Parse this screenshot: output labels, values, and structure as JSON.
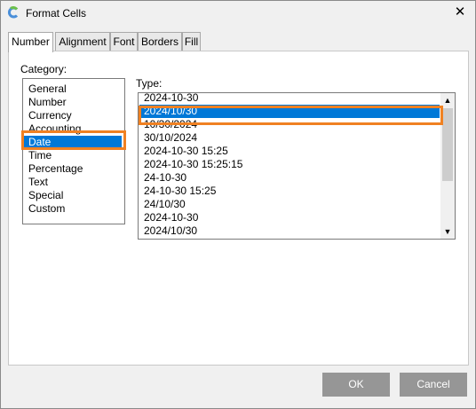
{
  "window": {
    "title": "Format Cells",
    "close_glyph": "✕",
    "icon": "app-logo-icon"
  },
  "tabs": [
    {
      "label": "Number",
      "active": true
    },
    {
      "label": "Alignment",
      "active": false
    },
    {
      "label": "Font",
      "active": false
    },
    {
      "label": "Borders",
      "active": false
    },
    {
      "label": "Fill",
      "active": false
    }
  ],
  "category": {
    "label": "Category:",
    "items": [
      "General",
      "Number",
      "Currency",
      "Accounting",
      "Date",
      "Time",
      "Percentage",
      "Text",
      "Special",
      "Custom"
    ],
    "selected": "Date"
  },
  "type": {
    "label": "Type:",
    "items": [
      "2024-10-30",
      "2024/10/30",
      "10/30/2024",
      "30/10/2024",
      "2024-10-30 15:25",
      "2024-10-30 15:25:15",
      "24-10-30",
      "24-10-30 15:25",
      "24/10/30",
      "2024-10-30",
      "2024/10/30"
    ],
    "selected": "2024/10/30"
  },
  "buttons": {
    "ok": "OK",
    "cancel": "Cancel"
  },
  "colors": {
    "selection": "#0078d7",
    "highlight": "#f08122",
    "button": "#969696"
  }
}
